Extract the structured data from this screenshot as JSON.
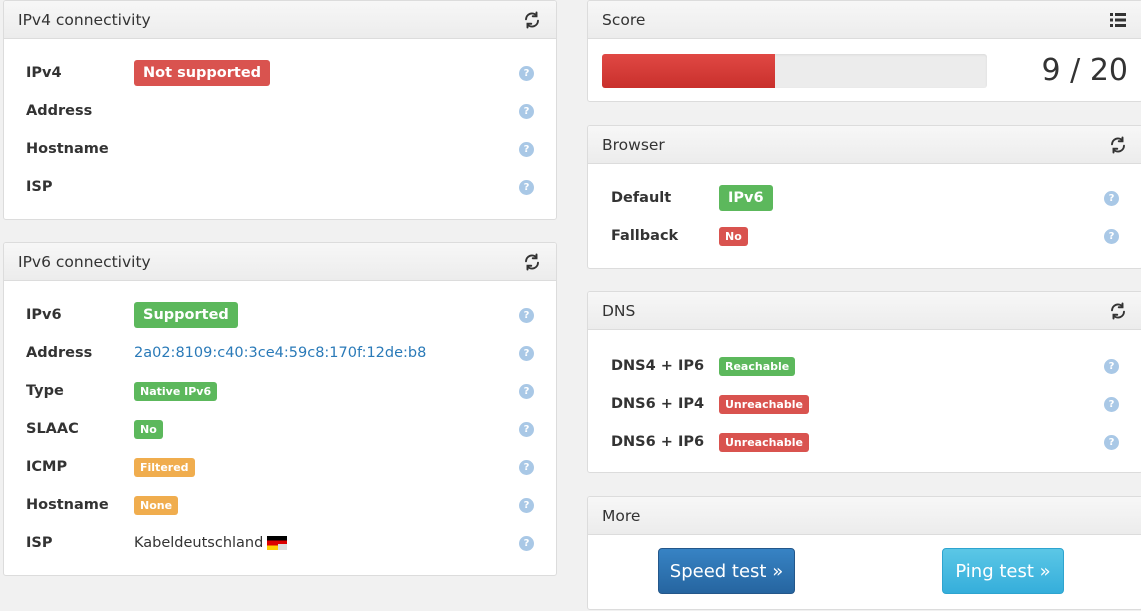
{
  "ipv4": {
    "title": "IPv4 connectivity",
    "rows": [
      {
        "label": "IPv4",
        "badge": "Not supported"
      },
      {
        "label": "Address",
        "value": ""
      },
      {
        "label": "Hostname",
        "value": ""
      },
      {
        "label": "ISP",
        "value": ""
      }
    ]
  },
  "ipv6": {
    "title": "IPv6 connectivity",
    "rows": [
      {
        "label": "IPv6",
        "badge": "Supported"
      },
      {
        "label": "Address",
        "value": "2a02:8109:c40:3ce4:59c8:170f:12de:b8"
      },
      {
        "label": "Type",
        "badge": "Native IPv6"
      },
      {
        "label": "SLAAC",
        "badge": "No"
      },
      {
        "label": "ICMP",
        "badge": "Filtered"
      },
      {
        "label": "Hostname",
        "badge": "None"
      },
      {
        "label": "ISP",
        "value": "Kabeldeutschland"
      }
    ]
  },
  "score": {
    "title": "Score",
    "value": 9,
    "max": 20,
    "text": "9 / 20"
  },
  "browser": {
    "title": "Browser",
    "rows": [
      {
        "label": "Default",
        "badge": "IPv6"
      },
      {
        "label": "Fallback",
        "badge": "No"
      }
    ]
  },
  "dns": {
    "title": "DNS",
    "rows": [
      {
        "label": "DNS4 + IP6",
        "badge": "Reachable"
      },
      {
        "label": "DNS6 + IP4",
        "badge": "Unreachable"
      },
      {
        "label": "DNS6 + IP6",
        "badge": "Unreachable"
      }
    ]
  },
  "more": {
    "title": "More",
    "speed_test": "Speed test »",
    "ping_test": "Ping test »"
  },
  "help_glyph": "?",
  "colors": {
    "danger": "#d9534f",
    "success": "#5cb85c",
    "warning": "#f0ad4e",
    "link": "#2a7ab8",
    "primary": "#2a6fb0",
    "info": "#46b8da"
  },
  "icons": {
    "refresh": "refresh-icon",
    "list": "list-icon",
    "help": "help-icon",
    "flag": "germany-flag-icon"
  }
}
